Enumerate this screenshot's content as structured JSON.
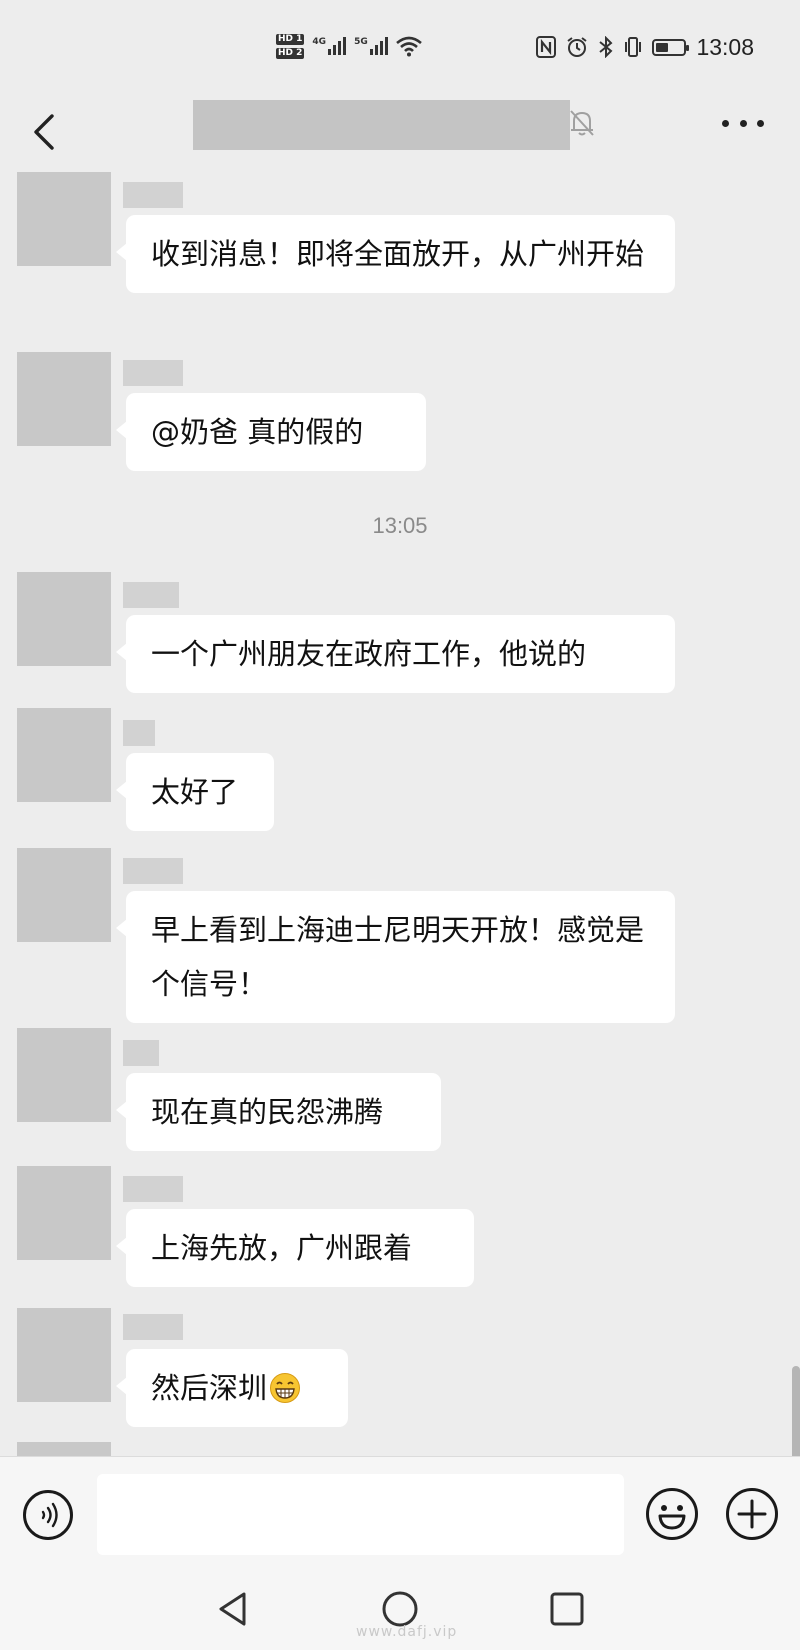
{
  "status_bar": {
    "sim1": "HD 1",
    "sim2": "HD 2",
    "net1": "4G",
    "net2": "5G",
    "time": "13:08",
    "battery_level": 0.45,
    "icons": [
      "nfc-icon",
      "alarm-icon",
      "bluetooth-icon",
      "vibrate-icon",
      "battery-icon"
    ]
  },
  "header": {
    "back_icon": "chevron-left-icon",
    "title_redacted": true,
    "mute_icon": "bell-off-icon",
    "more_icon": "more-dots-icon"
  },
  "messages": [
    {
      "text": "收到消息！即将全面放开，从广州开始"
    },
    {
      "text": "@奶爸  真的假的"
    },
    {
      "timestamp": "13:05"
    },
    {
      "text": "一个广州朋友在政府工作，他说的"
    },
    {
      "text": "太好了"
    },
    {
      "text": "早上看到上海迪士尼明天开放！感觉是个信号！"
    },
    {
      "text": "现在真的民怨沸腾"
    },
    {
      "text": "上海先放，广州跟着"
    },
    {
      "text": "然后深圳",
      "emoji": "grin-emoji"
    }
  ],
  "input_bar": {
    "voice_icon": "voice-icon",
    "input_value": "",
    "emoji_icon": "smiley-icon",
    "plus_icon": "plus-circle-icon"
  },
  "nav_bar": {
    "icons": [
      "nav-back-icon",
      "nav-home-icon",
      "nav-recent-icon"
    ],
    "watermark": "www.dafj.vip"
  },
  "colors": {
    "background": "#ededed",
    "bubble": "#ffffff",
    "redaction": "#c8c8c8",
    "timestamp": "#8a8a8a"
  }
}
